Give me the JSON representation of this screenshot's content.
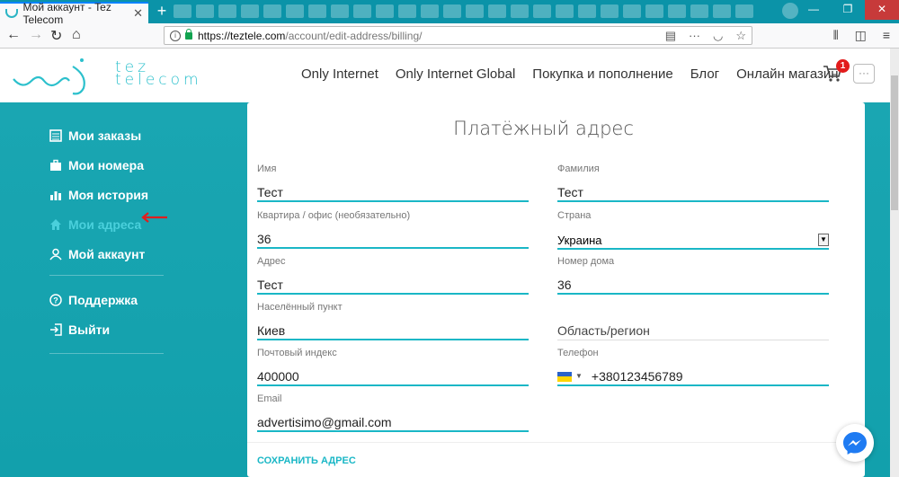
{
  "browser": {
    "tab_title": "Мой аккаунт - Tez Telecom",
    "url_host": "https://teztele.com",
    "url_path": "/account/edit-address/billing/"
  },
  "site": {
    "logo_line1": "tez",
    "logo_line2": "telecom",
    "nav": [
      "Only Internet",
      "Only Internet Global",
      "Покупка и пополнение",
      "Блог",
      "Онлайн магазин"
    ],
    "cart_count": "1",
    "more_label": "···"
  },
  "sidebar": {
    "items": [
      {
        "label": "Мои заказы",
        "icon": "list-icon"
      },
      {
        "label": "Мои номера",
        "icon": "briefcase-icon"
      },
      {
        "label": "Моя история",
        "icon": "bar-chart-icon"
      },
      {
        "label": "Мои адреса",
        "icon": "home-icon",
        "active": true
      },
      {
        "label": "Мой аккаунт",
        "icon": "user-icon"
      }
    ],
    "support": "Поддержка",
    "logout": "Выйти"
  },
  "form": {
    "title": "Платёжный адрес",
    "first_name_label": "Имя",
    "first_name": "Тест",
    "last_name_label": "Фамилия",
    "last_name": "Тест",
    "apt_label": "Квартира / офис (необязательно)",
    "apt": "36",
    "country_label": "Страна",
    "country": "Украина",
    "address_label": "Адрес",
    "address": "Тест",
    "house_label": "Номер дома",
    "house": "36",
    "city_label": "Населённый пункт",
    "city": "Киев",
    "region_placeholder": "Область/регион",
    "zip_label": "Почтовый индекс",
    "zip": "400000",
    "phone_label": "Телефон",
    "phone": "+380123456789",
    "email_label": "Email",
    "email": "advertisimo@gmail.com",
    "save_label": "СОХРАНИТЬ АДРЕС"
  },
  "colors": {
    "accent": "#1ab7c6",
    "background": "#12a0ac",
    "badge": "#e21b1b"
  }
}
